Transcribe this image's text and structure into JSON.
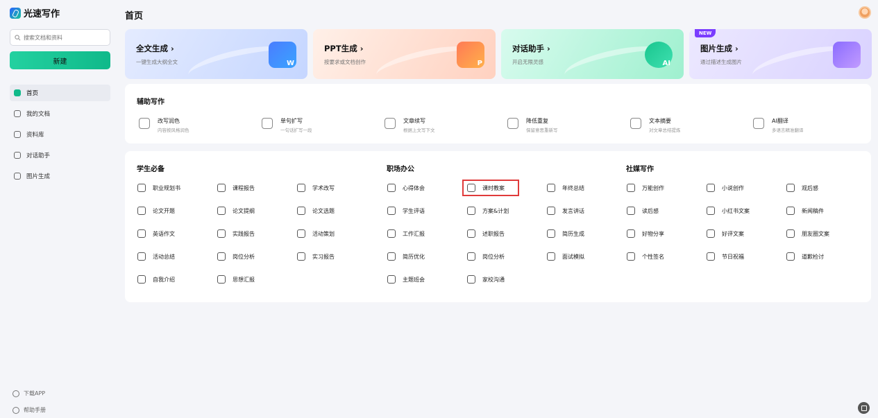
{
  "app": {
    "name": "光速写作"
  },
  "search": {
    "placeholder": "搜索文档和资料"
  },
  "new_button": "新建",
  "nav": [
    {
      "label": "首页",
      "icon": "home-icon",
      "active": true
    },
    {
      "label": "我的文档",
      "icon": "document-icon"
    },
    {
      "label": "资料库",
      "icon": "folder-icon"
    },
    {
      "label": "对话助手",
      "icon": "chat-icon"
    },
    {
      "label": "图片生成",
      "icon": "image-icon"
    }
  ],
  "sidebar_bottom": [
    {
      "label": "下载APP",
      "icon": "download-icon"
    },
    {
      "label": "帮助手册",
      "icon": "help-icon"
    }
  ],
  "page_title": "首页",
  "feature_cards": [
    {
      "title": "全文生成 ›",
      "subtitle": "一键生成大纲全文",
      "art_text": "W",
      "color": "#4a7dff"
    },
    {
      "title": "PPT生成 ›",
      "subtitle": "按要求或文档创作",
      "art_text": "P",
      "color": "#ff7a55"
    },
    {
      "title": "对话助手 ›",
      "subtitle": "开启无限灵感",
      "art_text": "AI",
      "color": "#19c58e"
    },
    {
      "title": "图片生成 ›",
      "subtitle": "通过描述生成图片",
      "art_text": "",
      "color": "#8b6cff",
      "badge": "NEW"
    }
  ],
  "assist": {
    "title": "辅助写作",
    "items": [
      {
        "name": "改写润色",
        "desc": "内容按风格润色",
        "icon": "rewrite-icon"
      },
      {
        "name": "单句扩写",
        "desc": "一句话扩写一段",
        "icon": "expand-icon"
      },
      {
        "name": "文章续写",
        "desc": "根据上文写下文",
        "icon": "continue-icon"
      },
      {
        "name": "降低重复",
        "desc": "保留意思重新写",
        "icon": "dedup-icon"
      },
      {
        "name": "文本摘要",
        "desc": "对文章总结提炼",
        "icon": "summary-icon"
      },
      {
        "name": "AI翻译",
        "desc": "多语言精准翻译",
        "icon": "translate-icon"
      }
    ]
  },
  "sections": [
    {
      "title": "学生必备",
      "items": [
        "职业规划书",
        "课程报告",
        "学术改写",
        "论文开题",
        "论文提纲",
        "论文选题",
        "英语作文",
        "实践报告",
        "活动策划",
        "活动总结",
        "岗位分析",
        "实习报告",
        "自我介绍",
        "思想汇报"
      ]
    },
    {
      "title": "职场办公",
      "items": [
        "心得体会",
        "课时教案",
        "年终总结",
        "学生评语",
        "方案&计划",
        "发言讲话",
        "工作汇报",
        "述职报告",
        "简历生成",
        "简历优化",
        "岗位分析",
        "面试模拟",
        "主题班会",
        "家校沟通"
      ],
      "highlighted": "课时教案"
    },
    {
      "title": "社媒写作",
      "items": [
        "万能创作",
        "小说创作",
        "观后感",
        "读后感",
        "小红书文案",
        "新闻稿件",
        "好物分享",
        "好评文案",
        "朋友圈文案",
        "个性签名",
        "节日祝福",
        "道歉检讨"
      ]
    }
  ]
}
